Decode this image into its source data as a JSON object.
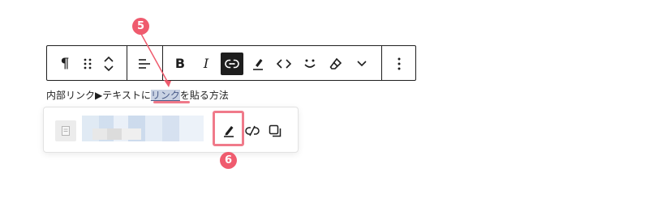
{
  "toolbar": {
    "buttons": [
      {
        "name": "paragraph-block-icon",
        "glyph": "¶"
      },
      {
        "name": "drag-handle-icon"
      },
      {
        "name": "move-up-down-icon"
      },
      {
        "name": "align-text-icon"
      },
      {
        "name": "bold-button",
        "glyph": "B"
      },
      {
        "name": "italic-button",
        "glyph": "I"
      },
      {
        "name": "link-button",
        "active": true
      },
      {
        "name": "highlight-button"
      },
      {
        "name": "inline-code-button",
        "glyph": "<>"
      },
      {
        "name": "emoji-button"
      },
      {
        "name": "clear-formatting-button"
      },
      {
        "name": "more-rich-text-chevron"
      },
      {
        "name": "more-options-button",
        "glyph": "⋮"
      }
    ]
  },
  "paragraph": {
    "before": "内部リンク▶テキストに",
    "selected": "リンク",
    "after": "を貼る方法"
  },
  "popover": {
    "buttons": [
      "edit-link-button",
      "unlink-button",
      "copy-link-button"
    ]
  },
  "annotations": {
    "step5": "5",
    "step6": "6"
  },
  "colors": {
    "accent": "#ef5b6e",
    "toolbar_active": "#1e1e1e",
    "selection": "#c9d2e3"
  }
}
